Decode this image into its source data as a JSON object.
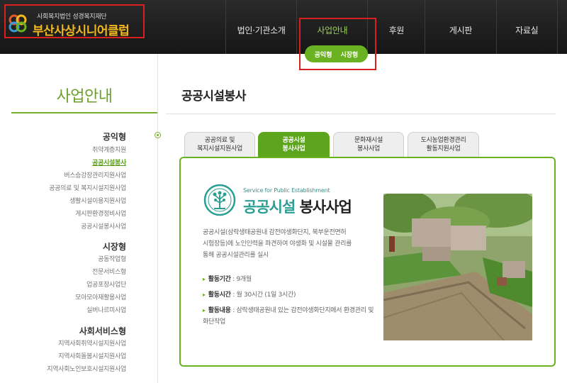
{
  "header": {
    "logo_sub": "사회복지법인 성경복지재단",
    "logo_main": "부산사상시니어클럽",
    "nav": [
      {
        "label": "법인·기관소개"
      },
      {
        "label": "사업안내"
      },
      {
        "label": "후원"
      },
      {
        "label": "게시판"
      },
      {
        "label": "자료실"
      }
    ],
    "submenu": [
      "공익형",
      "시장형"
    ]
  },
  "sidebar": {
    "title": "사업안내",
    "groups": [
      {
        "label": "공익형",
        "items": [
          "취약계층지원",
          "공공시설봉사",
          "버스승강장관리지원사업",
          "공공의료 및 복지시설지원사업",
          "생활시설이용지원사업",
          "게시판환경정비사업",
          "공공시설봉사사업"
        ]
      },
      {
        "label": "시장형",
        "items": [
          "공동작업형",
          "전문서비스형",
          "업공포장사업단",
          "모아모아재활용사업",
          "실버나르미사업"
        ]
      },
      {
        "label": "사회서비스형",
        "items": [
          "지역사회취약시설지원사업",
          "지역사회돌봄시설지원사업",
          "지역사회노인보호시설지원사업"
        ]
      }
    ]
  },
  "content": {
    "page_title": "공공시설봉사",
    "tabs": [
      {
        "line1": "공공의료 및",
        "line2": "복지시설지원사업"
      },
      {
        "line1": "공공시설",
        "line2": "봉사사업"
      },
      {
        "line1": "문화재시설",
        "line2": "봉사사업"
      },
      {
        "line1": "도시농업환경관리",
        "line2": "활동지원사업"
      }
    ],
    "eng_sub": "Service for Public Establishment",
    "title_part1": "공공시설",
    "title_part2": " 봉사사업",
    "desc_lines": [
      "공공시설(삼락생태공원내 감전야생화단지, 북부운전면허",
      "시험장등)에 노인인력을 파견하여 야생화 및 시설물 관리를",
      "통해 공공시설관리를 실시"
    ],
    "info": [
      {
        "label": "활동기간",
        "value": " : 9개월"
      },
      {
        "label": "활동시간",
        "value": " : 월 30시간 (1일 3시간)"
      },
      {
        "label": "활동내용",
        "value": " : 삼락생태공원내 있는 감전야생화단지에서 환경관리 및 화단작업"
      }
    ]
  },
  "colors": {
    "accent_green": "#6ab222",
    "teal": "#2b9e94",
    "highlight_red": "#d9201f",
    "logo_yellow": "#f2b81f"
  }
}
